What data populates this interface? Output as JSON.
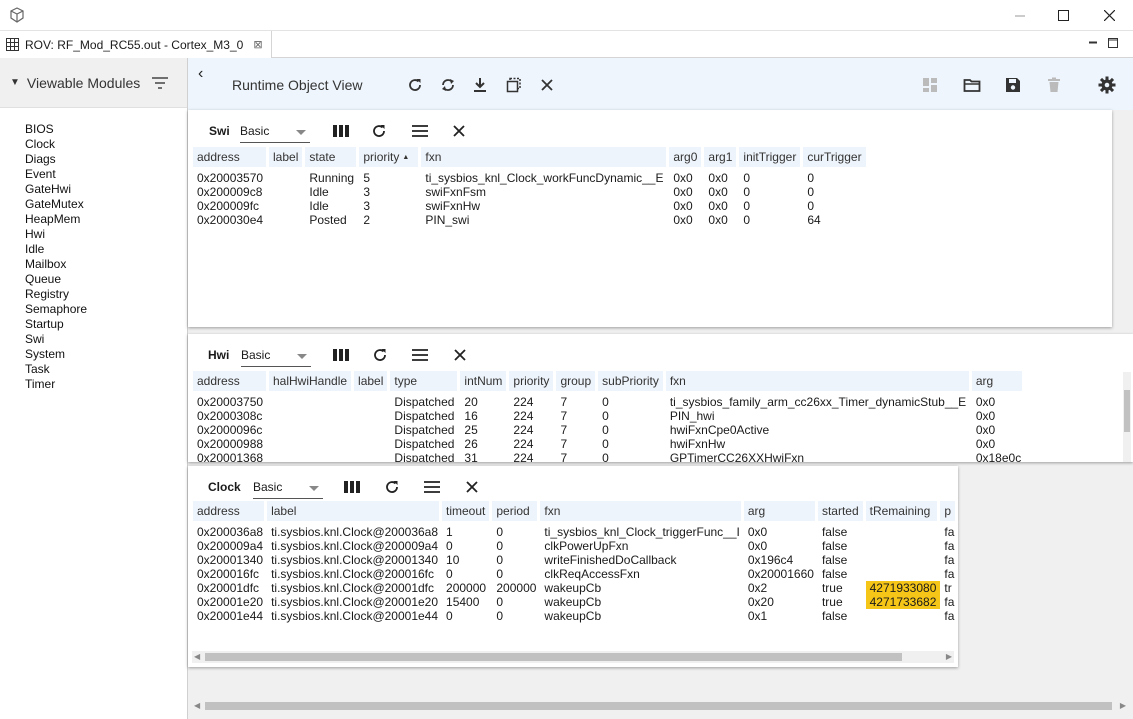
{
  "window": {
    "minimize_icon": "minimize-icon",
    "maximize_icon": "maximize-icon",
    "close_icon": "close-icon"
  },
  "tab": {
    "label": "ROV: RF_Mod_RC55.out - Cortex_M3_0",
    "close": "⊠"
  },
  "sidebar": {
    "title": "Viewable Modules",
    "modules": [
      "BIOS",
      "Clock",
      "Diags",
      "Event",
      "GateHwi",
      "GateMutex",
      "HeapMem",
      "Hwi",
      "Idle",
      "Mailbox",
      "Queue",
      "Registry",
      "Semaphore",
      "Startup",
      "Swi",
      "System",
      "Task",
      "Timer"
    ]
  },
  "toolbar": {
    "title": "Runtime Object View"
  },
  "swi": {
    "name": "Swi",
    "view": "Basic",
    "columns": [
      "address",
      "label",
      "state",
      "priority",
      "fxn",
      "arg0",
      "arg1",
      "initTrigger",
      "curTrigger"
    ],
    "rows": [
      [
        "0x20003570",
        "",
        "Running",
        "5",
        "ti_sysbios_knl_Clock_workFuncDynamic__E",
        "0x0",
        "0x0",
        "0",
        "0"
      ],
      [
        "0x200009c8",
        "",
        "Idle",
        "3",
        "swiFxnFsm",
        "0x0",
        "0x0",
        "0",
        "0"
      ],
      [
        "0x200009fc",
        "",
        "Idle",
        "3",
        "swiFxnHw",
        "0x0",
        "0x0",
        "0",
        "0"
      ],
      [
        "0x200030e4",
        "",
        "Posted",
        "2",
        "PIN_swi",
        "0x0",
        "0x0",
        "0",
        "64"
      ]
    ]
  },
  "hwi": {
    "name": "Hwi",
    "view": "Basic",
    "columns": [
      "address",
      "halHwiHandle",
      "label",
      "type",
      "intNum",
      "priority",
      "group",
      "subPriority",
      "fxn",
      "arg"
    ],
    "rows": [
      [
        "0x20003750",
        "",
        "",
        "Dispatched",
        "20",
        "224",
        "7",
        "0",
        "ti_sysbios_family_arm_cc26xx_Timer_dynamicStub__E",
        "0x0"
      ],
      [
        "0x2000308c",
        "",
        "",
        "Dispatched",
        "16",
        "224",
        "7",
        "0",
        "PIN_hwi",
        "0x0"
      ],
      [
        "0x2000096c",
        "",
        "",
        "Dispatched",
        "25",
        "224",
        "7",
        "0",
        "hwiFxnCpe0Active",
        "0x0"
      ],
      [
        "0x20000988",
        "",
        "",
        "Dispatched",
        "26",
        "224",
        "7",
        "0",
        "hwiFxnHw",
        "0x0"
      ],
      [
        "0x20001368",
        "",
        "",
        "Dispatched",
        "31",
        "224",
        "7",
        "0",
        "GPTimerCC26XXHwiFxn",
        "0x18e0c"
      ]
    ]
  },
  "clock": {
    "name": "Clock",
    "view": "Basic",
    "columns": [
      "address",
      "label",
      "timeout",
      "period",
      "fxn",
      "arg",
      "started",
      "tRemaining",
      "p"
    ],
    "rows": [
      [
        "0x200036a8",
        "ti.sysbios.knl.Clock@200036a8",
        "1",
        "0",
        "ti_sysbios_knl_Clock_triggerFunc__I",
        "0x0",
        "false",
        "",
        "fa"
      ],
      [
        "0x200009a4",
        "ti.sysbios.knl.Clock@200009a4",
        "0",
        "0",
        "clkPowerUpFxn",
        "0x0",
        "false",
        "",
        "fa"
      ],
      [
        "0x20001340",
        "ti.sysbios.knl.Clock@20001340",
        "10",
        "0",
        "writeFinishedDoCallback",
        "0x196c4",
        "false",
        "",
        "fa"
      ],
      [
        "0x200016fc",
        "ti.sysbios.knl.Clock@200016fc",
        "0",
        "0",
        "clkReqAccessFxn",
        "0x20001660",
        "false",
        "",
        "fa"
      ],
      [
        "0x20001dfc",
        "ti.sysbios.knl.Clock@20001dfc",
        "200000",
        "200000",
        "wakeupCb",
        "0x2",
        "true",
        "4271933080",
        "tr"
      ],
      [
        "0x20001e20",
        "ti.sysbios.knl.Clock@20001e20",
        "15400",
        "0",
        "wakeupCb",
        "0x20",
        "true",
        "4271733682",
        "fa"
      ],
      [
        "0x20001e44",
        "ti.sysbios.knl.Clock@20001e44",
        "0",
        "0",
        "wakeupCb",
        "0x1",
        "false",
        "",
        "fa"
      ]
    ]
  },
  "colors": {
    "highlight": "#f5c518",
    "header_bg": "#eef4fb",
    "toolbar_bg": "#eef5fc"
  }
}
